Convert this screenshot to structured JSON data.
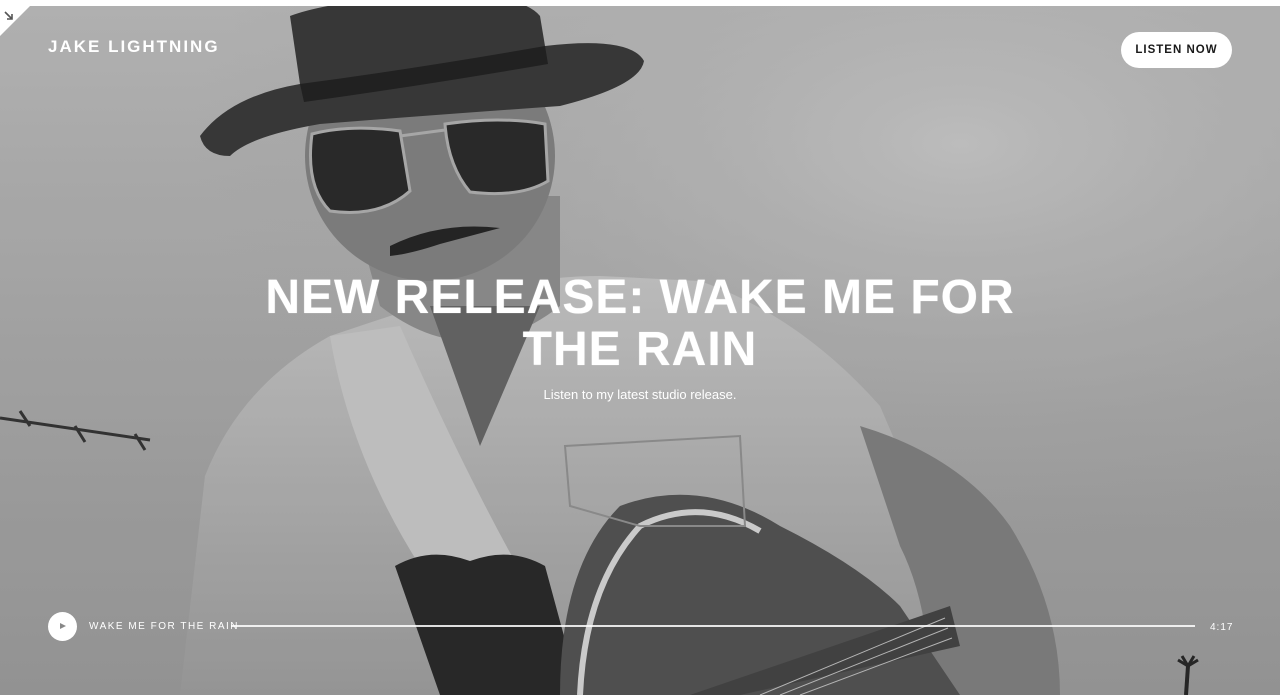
{
  "site": {
    "brand": "JAKE LIGHTNING",
    "cta_label": "LISTEN NOW"
  },
  "hero": {
    "headline": "NEW RELEASE: WAKE ME FOR THE RAIN",
    "subtitle": "Listen to my latest studio release.",
    "image_style": "black-and-white photo"
  },
  "player": {
    "track_title": "WAKE ME FOR THE RAIN",
    "duration": "4:17",
    "progress": 0
  },
  "icons": {
    "play": "play-icon",
    "corner": "expand-corner-icon"
  },
  "colors": {
    "text": "#ffffff",
    "button_bg": "#ffffff",
    "button_text": "#1a1a1a"
  }
}
